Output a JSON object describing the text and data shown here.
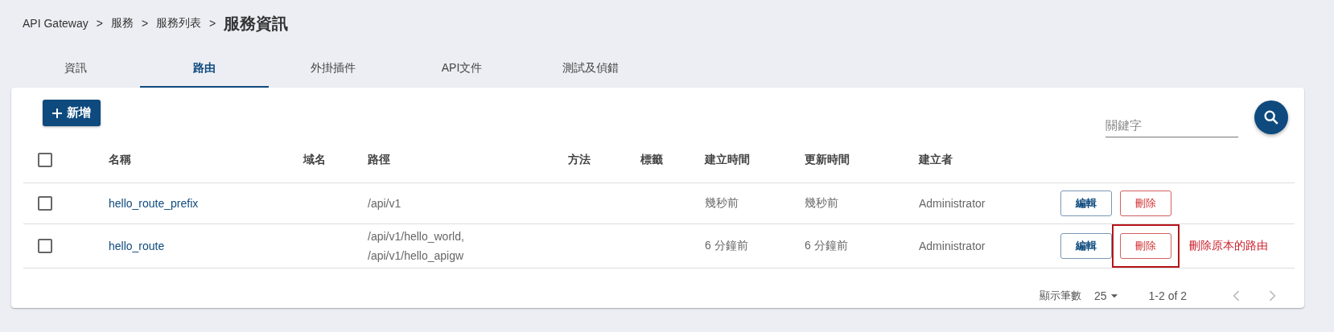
{
  "breadcrumb": {
    "items": [
      "API Gateway",
      "服務",
      "服務列表"
    ],
    "separator": ">",
    "current": "服務資訊"
  },
  "tabs": [
    {
      "label": "資訊",
      "selected": false
    },
    {
      "label": "路由",
      "selected": true
    },
    {
      "label": "外掛插件",
      "selected": false
    },
    {
      "label": "API文件",
      "selected": false
    },
    {
      "label": "測試及偵錯",
      "selected": false
    }
  ],
  "toolbar": {
    "add_button": "新增",
    "search": {
      "placeholder": "關鍵字"
    }
  },
  "table": {
    "select_all": {
      "checked": false
    },
    "columns": [
      "名稱",
      "域名",
      "路徑",
      "方法",
      "標籤",
      "建立時間",
      "更新時間",
      "建立者"
    ],
    "rows": [
      {
        "checked": false,
        "name": "hello_route_prefix",
        "paths": [
          "/api/v1"
        ],
        "created": "幾秒前",
        "updated": "幾秒前",
        "creator": "Administrator",
        "edit": "編輯",
        "delete": "刪除",
        "highlighted": false
      },
      {
        "checked": false,
        "name": "hello_route",
        "paths": [
          "/api/v1/hello_world,",
          "/api/v1/hello_apigw"
        ],
        "created": "6 分鐘前",
        "updated": "6 分鐘前",
        "creator": "Administrator",
        "edit": "編輯",
        "delete": "刪除",
        "highlighted": true,
        "note": "刪除原本的路由"
      }
    ]
  },
  "pagination": {
    "rows_label": "顯示筆數",
    "rows_per_page": "25",
    "range": "1-2 of 2",
    "prev_disabled": true,
    "next_disabled": true
  }
}
